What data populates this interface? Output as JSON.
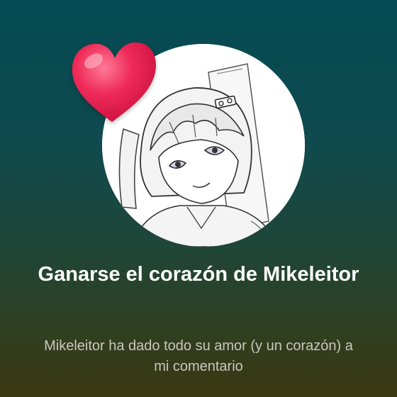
{
  "achievement": {
    "title": "Ganarse el corazón de Mikeleitor",
    "description": "Mikeleitor ha dado todo su amor (y un corazón) a mi comentario",
    "avatar_icon": "anime-character-sketch",
    "badge_icon": "heart-icon"
  },
  "colors": {
    "background_top": "#044a52",
    "background_bottom": "#3a3712",
    "heart": "#e8204f",
    "title": "#ffffff",
    "description": "#c9c7bd"
  }
}
